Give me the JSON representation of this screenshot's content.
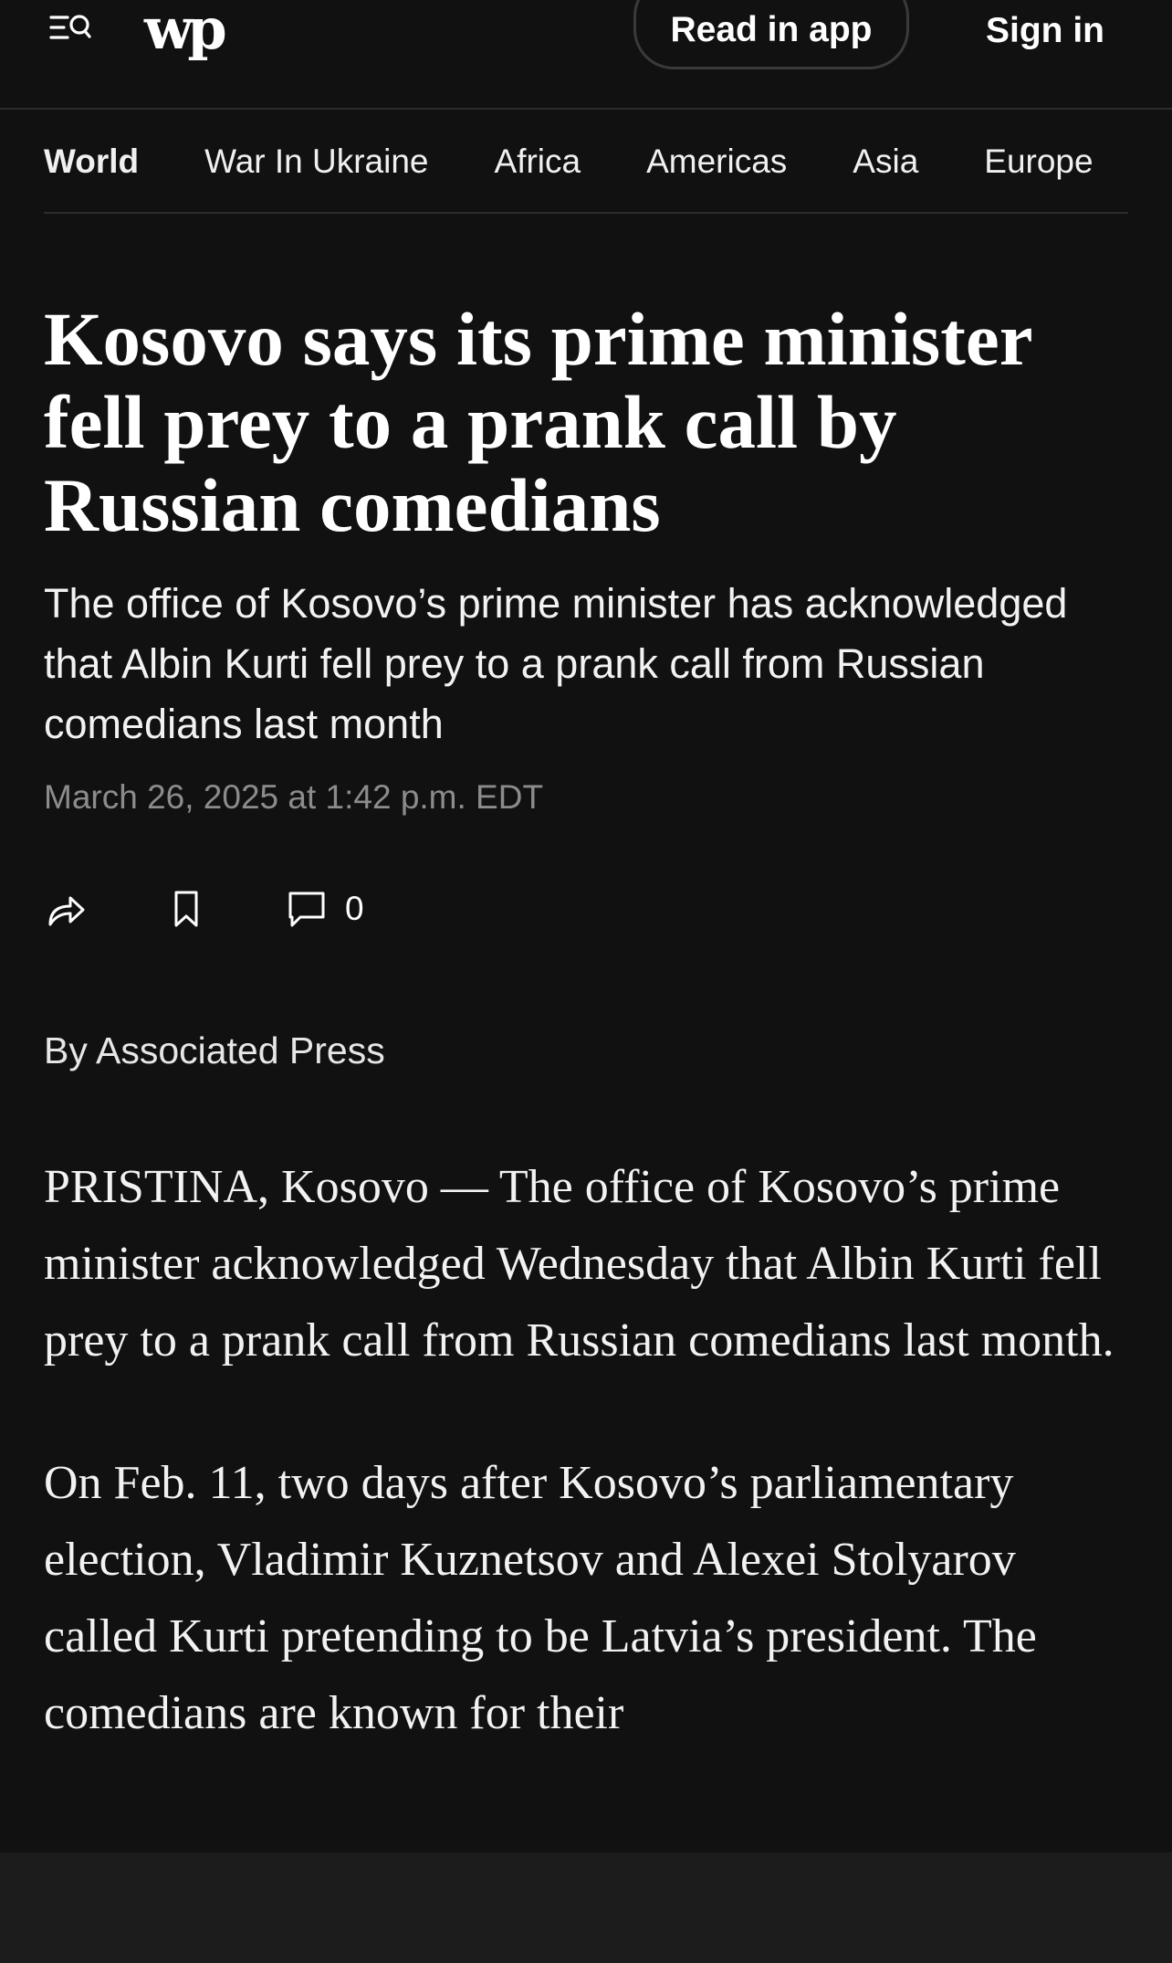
{
  "header": {
    "logo_text": "wp",
    "read_in_app": "Read in app",
    "sign_in": "Sign in",
    "icons": [
      "menu-search-icon"
    ]
  },
  "subnav": {
    "tabs": [
      {
        "label": "World",
        "active": true
      },
      {
        "label": "War In Ukraine",
        "active": false
      },
      {
        "label": "Africa",
        "active": false
      },
      {
        "label": "Americas",
        "active": false
      },
      {
        "label": "Asia",
        "active": false
      },
      {
        "label": "Europe",
        "active": false
      }
    ]
  },
  "article": {
    "headline": "Kosovo says its prime minister fell prey to a prank call by Russian comedians",
    "dek": "The office of Kosovo’s prime minister has acknowledged that Albin Kurti fell prey to a prank call from Russian comedians last month",
    "timestamp": "March 26, 2025 at 1:42 p.m. EDT",
    "actions": {
      "icons": [
        "share-icon",
        "bookmark-icon",
        "comment-icon"
      ],
      "comment_count": "0"
    },
    "byline": "By Associated Press",
    "paragraphs": [
      "PRISTINA, Kosovo — The office of Kosovo’s prime minister acknowledged Wednesday that Albin Kurti fell prey to a prank call from Russian comedians last month.",
      "On Feb. 11, two days after Kosovo’s parliamentary election, Vladimir Kuznetsov and Alexei Stolyarov called Kurti pretending to be Latvia’s president. The comedians are known for their"
    ]
  },
  "colors": {
    "background": "#111111",
    "text": "#ffffff",
    "muted": "#8c8c8c",
    "divider": "#2c2c2c",
    "bottom_bar": "#1c1c1c"
  }
}
